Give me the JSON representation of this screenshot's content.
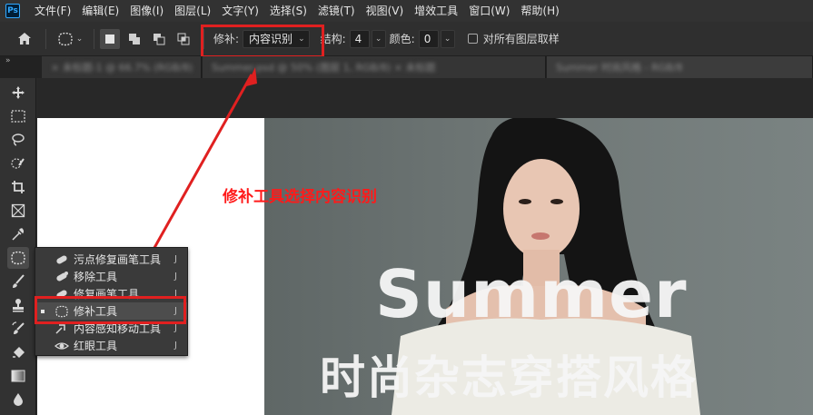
{
  "app": {
    "logo_text": "Ps"
  },
  "menu": [
    "文件(F)",
    "编辑(E)",
    "图像(I)",
    "图层(L)",
    "文字(Y)",
    "选择(S)",
    "滤镜(T)",
    "视图(V)",
    "增效工具",
    "窗口(W)",
    "帮助(H)"
  ],
  "options": {
    "patch_label": "修补:",
    "patch_value": "内容识别",
    "structure_label": "结构:",
    "structure_value": "4",
    "color_label": "颜色:",
    "color_value": "0",
    "sample_all_label": "对所有图层取样"
  },
  "tabs": {
    "collapse_glyph": "»",
    "tab1_text": "× 未标题-1 @ 66.7% (RGB/8)",
    "tab2_text": "Summer.psd @ 50% (图层 1, RGB/8) × 未标题",
    "tab3_text": "Summer 时尚风格 - RGB/8"
  },
  "canvas": {
    "headline": "Summer",
    "subline": "时尚杂志穿搭风格"
  },
  "annotation": {
    "text": "修补工具选择内容识别"
  },
  "flyout": {
    "items": [
      {
        "label": "污点修复画笔工具",
        "key": "J",
        "selected": false
      },
      {
        "label": "移除工具",
        "key": "J",
        "selected": false
      },
      {
        "label": "修复画笔工具",
        "key": "J",
        "selected": false
      },
      {
        "label": "修补工具",
        "key": "J",
        "selected": true
      },
      {
        "label": "内容感知移动工具",
        "key": "J",
        "selected": false
      },
      {
        "label": "红眼工具",
        "key": "J",
        "selected": false
      }
    ]
  },
  "colors": {
    "accent_red": "#e02020",
    "app_dark": "#323232",
    "ps_blue": "#31a8ff"
  }
}
